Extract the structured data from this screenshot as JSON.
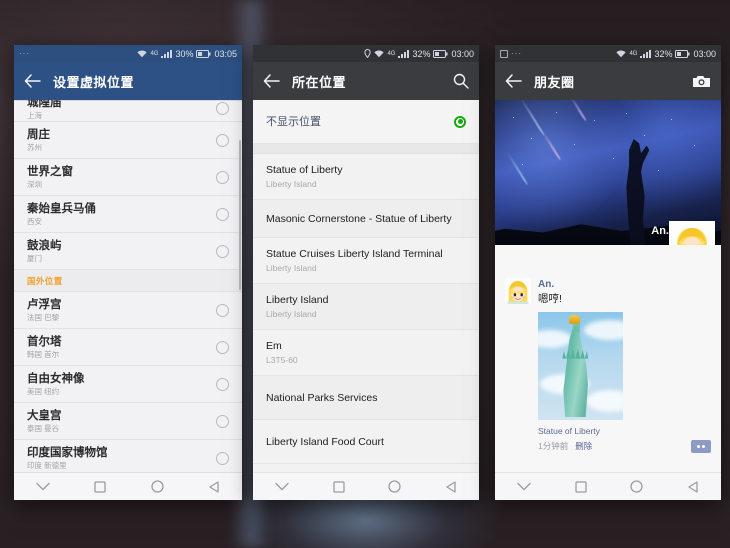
{
  "scene": {
    "description": "three-android-phone-screens"
  },
  "phone1": {
    "status": {
      "left_dots": "···",
      "wifi": "wifi-icon",
      "network": "4G",
      "signal": "signal-icon",
      "battery_pct": "30%",
      "battery": "battery-icon",
      "clock": "03:05"
    },
    "appbar": {
      "back": "back-arrow-icon",
      "title": "设置虚拟位置"
    },
    "list": [
      {
        "title": "城隍庙",
        "sub": "上海",
        "selected": false,
        "partial": true
      },
      {
        "title": "周庄",
        "sub": "苏州",
        "selected": false
      },
      {
        "title": "世界之窗",
        "sub": "深圳",
        "selected": false
      },
      {
        "title": "秦始皇兵马俑",
        "sub": "西安",
        "selected": false
      },
      {
        "title": "鼓浪屿",
        "sub": "厦门",
        "selected": false
      }
    ],
    "group_header": "国外位置",
    "list2": [
      {
        "title": "卢浮宫",
        "sub": "法国 巴黎",
        "selected": false
      },
      {
        "title": "首尔塔",
        "sub": "韩国 首尔",
        "selected": false
      },
      {
        "title": "自由女神像",
        "sub": "美国 纽约",
        "selected": false
      },
      {
        "title": "大皇宫",
        "sub": "泰国 曼谷",
        "selected": false
      },
      {
        "title": "印度国家博物馆",
        "sub": "印度 新德里",
        "selected": false
      }
    ],
    "nav": [
      "chevron-down-icon",
      "square-icon",
      "circle-icon",
      "triangle-back-icon"
    ]
  },
  "phone2": {
    "status": {
      "location": "location-icon",
      "wifi": "wifi-icon",
      "network": "4G",
      "signal": "signal-icon",
      "battery_pct": "32%",
      "battery": "battery-icon",
      "clock": "03:00"
    },
    "appbar": {
      "back": "back-arrow-icon",
      "title": "所在位置",
      "search": "search-icon"
    },
    "none_option": {
      "label": "不显示位置",
      "selected": true
    },
    "list": [
      {
        "title": "Statue of Liberty",
        "sub": "Liberty Island"
      },
      {
        "title": "Masonic Cornerstone - Statue of Liberty",
        "sub": ""
      },
      {
        "title": "Statue Cruises Liberty Island Terminal",
        "sub": "Liberty Island"
      },
      {
        "title": "Liberty Island",
        "sub": "Liberty Island"
      },
      {
        "title": "Em",
        "sub": "L3T5-60"
      },
      {
        "title": "National Parks Services",
        "sub": ""
      },
      {
        "title": "Liberty Island Food Court",
        "sub": ""
      }
    ],
    "nav": [
      "chevron-down-icon",
      "square-icon",
      "circle-icon",
      "triangle-back-icon"
    ]
  },
  "phone3": {
    "status": {
      "left_icon": "image-icon",
      "left_dots": "···",
      "wifi": "wifi-icon",
      "network": "4G",
      "signal": "signal-icon",
      "battery_pct": "32%",
      "battery": "battery-icon",
      "clock": "03:00"
    },
    "appbar": {
      "back": "back-arrow-icon",
      "title": "朋友圈",
      "camera": "camera-icon"
    },
    "cover": {
      "alt": "anime-night-sky-cover",
      "username": "An.",
      "avatar": "blonde-anime-avatar"
    },
    "post": {
      "user": "An.",
      "text": "嗯哼!",
      "image_alt": "statue-of-liberty-photo",
      "location": "Statue of Liberty",
      "time": "1分钟前",
      "delete": "删除",
      "comment": "comment-icon"
    },
    "nav": [
      "chevron-down-icon",
      "square-icon",
      "circle-icon",
      "triangle-back-icon"
    ]
  }
}
